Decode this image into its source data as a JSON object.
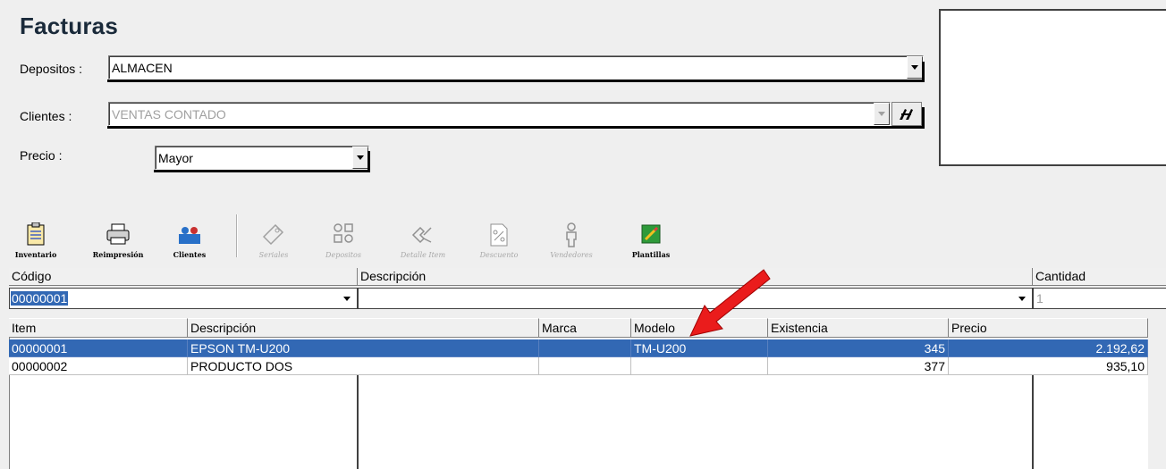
{
  "window": {
    "title": "Facturas"
  },
  "form": {
    "depositos": {
      "label": "Depositos :",
      "value": "ALMACEN"
    },
    "clientes": {
      "label": "Clientes :",
      "value": "VENTAS CONTADO"
    },
    "precio": {
      "label": "Precio :",
      "value": "Mayor"
    }
  },
  "toolbar": [
    {
      "label": "Inventario",
      "icon": "clipboard-icon",
      "enabled": true
    },
    {
      "label": "Reimpresión",
      "icon": "printer-icon",
      "enabled": true
    },
    {
      "label": "Clientes",
      "icon": "users-icon",
      "enabled": true
    },
    {
      "label": "Seriales",
      "icon": "tag-icon",
      "enabled": false
    },
    {
      "label": "Depositos",
      "icon": "grid-icon",
      "enabled": false
    },
    {
      "label": "Detalle Item",
      "icon": "detail-icon",
      "enabled": false
    },
    {
      "label": "Descuento",
      "icon": "percent-icon",
      "enabled": false
    },
    {
      "label": "Vendedores",
      "icon": "person-icon",
      "enabled": false
    },
    {
      "label": "Plantillas",
      "icon": "template-icon",
      "enabled": true
    }
  ],
  "entry": {
    "headers": {
      "codigo": "Código",
      "descripcion": "Descripción",
      "cantidad": "Cantidad"
    },
    "codigo_value": "00000001",
    "descripcion_value": "",
    "cantidad_value": "1"
  },
  "grid": {
    "columns": [
      "Item",
      "Descripción",
      "Marca",
      "Modelo",
      "Existencia",
      "Precio"
    ],
    "rows": [
      {
        "item": "00000001",
        "descripcion": "EPSON TM-U200",
        "marca": "",
        "modelo": "TM-U200",
        "existencia": "345",
        "precio": "2.192,62",
        "selected": true
      },
      {
        "item": "00000002",
        "descripcion": "PRODUCTO DOS",
        "marca": "",
        "modelo": "",
        "existencia": "377",
        "precio": "935,10",
        "selected": false
      }
    ]
  },
  "colors": {
    "selection": "#3268b4",
    "annotation_arrow": "#e01010"
  }
}
